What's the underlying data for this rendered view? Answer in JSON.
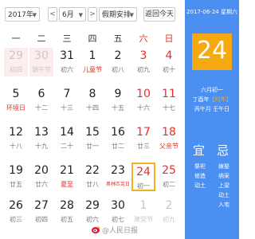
{
  "toolbar": {
    "year_value": "2017年",
    "month_value": "6月",
    "holiday_value": "假期安排",
    "today_label": "返回今天",
    "prev_glyph": "<",
    "next_glyph": ">"
  },
  "weekdays": [
    "一",
    "二",
    "三",
    "四",
    "五",
    "六",
    "日"
  ],
  "weeks": [
    [
      {
        "n": "29",
        "l": "初四",
        "other": true,
        "holiday": true
      },
      {
        "n": "30",
        "l": "端午节",
        "other": true,
        "holiday": true,
        "festival": true
      },
      {
        "n": "31",
        "l": "初六"
      },
      {
        "n": "1",
        "l": "儿童节",
        "festival": true
      },
      {
        "n": "2",
        "l": "初八"
      },
      {
        "n": "3",
        "l": "初九",
        "weekend": true
      },
      {
        "n": "4",
        "l": "初十",
        "weekend": true
      }
    ],
    [
      {
        "n": "5",
        "l": "环境日",
        "festival": true
      },
      {
        "n": "6",
        "l": "十二"
      },
      {
        "n": "7",
        "l": "十三"
      },
      {
        "n": "8",
        "l": "十四"
      },
      {
        "n": "9",
        "l": "十五"
      },
      {
        "n": "10",
        "l": "十六",
        "weekend": true
      },
      {
        "n": "11",
        "l": "十七",
        "weekend": true
      }
    ],
    [
      {
        "n": "12",
        "l": "十八"
      },
      {
        "n": "13",
        "l": "十九"
      },
      {
        "n": "14",
        "l": "二十"
      },
      {
        "n": "15",
        "l": "廿一"
      },
      {
        "n": "16",
        "l": "廿二"
      },
      {
        "n": "17",
        "l": "廿三",
        "weekend": true
      },
      {
        "n": "18",
        "l": "父亲节",
        "weekend": true,
        "festival": true
      }
    ],
    [
      {
        "n": "19",
        "l": "廿五"
      },
      {
        "n": "20",
        "l": "廿六"
      },
      {
        "n": "21",
        "l": "夏至",
        "festival": true
      },
      {
        "n": "22",
        "l": "廿八"
      },
      {
        "n": "23",
        "l": "奥林匹克日",
        "festival": true
      },
      {
        "n": "24",
        "l": "初一",
        "weekend": true,
        "today": true
      },
      {
        "n": "25",
        "l": "初二",
        "weekend": true
      }
    ],
    [
      {
        "n": "26",
        "l": "初三"
      },
      {
        "n": "27",
        "l": "初四"
      },
      {
        "n": "28",
        "l": "初五"
      },
      {
        "n": "29",
        "l": "初六"
      },
      {
        "n": "30",
        "l": "初七"
      },
      {
        "n": "1",
        "l": "建党节",
        "other": true
      },
      {
        "n": "2",
        "l": "初九",
        "other": true
      }
    ]
  ],
  "panel": {
    "date_line": "2017-06-24 星期六",
    "big_day": "24",
    "lunar_month_day": "六月初一",
    "ganzhi_year_pre": "丁酉年",
    "ganzhi_year_hl": "【鸡年】",
    "ganzhi_month_day": "丙午月 壬午日",
    "yi_label": "宜",
    "ji_label": "忌",
    "yi_items": [
      "祭祀",
      "修造",
      "动土"
    ],
    "ji_items": [
      "嫁娶",
      "纳采",
      "上梁",
      "动土",
      "入宅"
    ]
  },
  "watermark": "@人民日报",
  "colors": {
    "accent_blue": "#4b8ff0",
    "accent_orange": "#f5a911",
    "weekend_red": "#e0332b"
  }
}
